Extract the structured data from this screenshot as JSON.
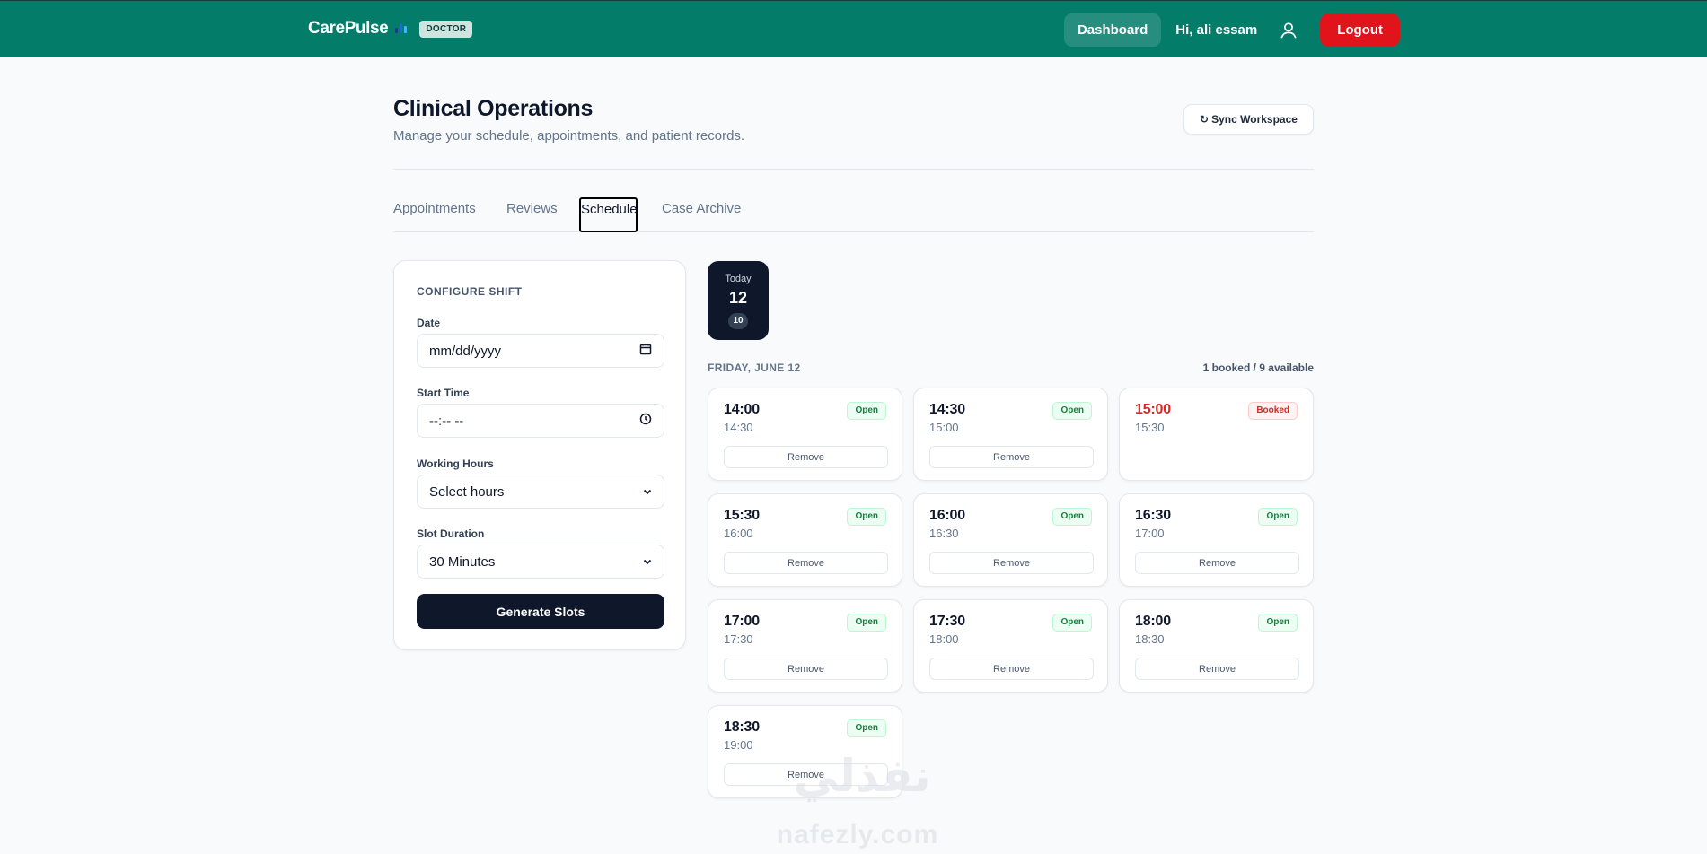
{
  "header": {
    "brand": "CarePulse",
    "role_badge": "DOCTOR",
    "dashboard": "Dashboard",
    "greeting": "Hi, ali essam",
    "logout": "Logout",
    "brand_color": "#047c6a",
    "logout_color": "#e0141a"
  },
  "page": {
    "title": "Clinical Operations",
    "subtitle": "Manage your schedule, appointments, and patient records.",
    "sync_button": "Sync Workspace"
  },
  "tabs": [
    {
      "label": "Appointments"
    },
    {
      "label": "Reviews"
    },
    {
      "label": "Schedule",
      "active": true
    },
    {
      "label": "Case Archive"
    }
  ],
  "config": {
    "title": "CONFIGURE SHIFT",
    "date_label": "Date",
    "date_value": "mm/dd/yyyy",
    "start_label": "Start Time",
    "start_value": "--:-- --",
    "hours_label": "Working Hours",
    "hours_value": "Select hours",
    "duration_label": "Slot Duration",
    "duration_value": "30 Minutes",
    "generate_button": "Generate Slots"
  },
  "day": {
    "label": "Today",
    "number": "12",
    "count": "10"
  },
  "schedule": {
    "date_heading": "FRIDAY, JUNE 12",
    "summary": "1 booked / 9 available"
  },
  "slots": [
    {
      "start": "14:00",
      "end": "14:30",
      "status": "Open",
      "action": "Remove"
    },
    {
      "start": "14:30",
      "end": "15:00",
      "status": "Open",
      "action": "Remove"
    },
    {
      "start": "15:00",
      "end": "15:30",
      "status": "Booked",
      "action": ""
    },
    {
      "start": "15:30",
      "end": "16:00",
      "status": "Open",
      "action": "Remove"
    },
    {
      "start": "16:00",
      "end": "16:30",
      "status": "Open",
      "action": "Remove"
    },
    {
      "start": "16:30",
      "end": "17:00",
      "status": "Open",
      "action": "Remove"
    },
    {
      "start": "17:00",
      "end": "17:30",
      "status": "Open",
      "action": "Remove"
    },
    {
      "start": "17:30",
      "end": "18:00",
      "status": "Open",
      "action": "Remove"
    },
    {
      "start": "18:00",
      "end": "18:30",
      "status": "Open",
      "action": "Remove"
    },
    {
      "start": "18:30",
      "end": "19:00",
      "status": "Open",
      "action": "Remove"
    }
  ],
  "watermark": {
    "arabic": "نفذلي",
    "latin": "nafezly.com"
  }
}
